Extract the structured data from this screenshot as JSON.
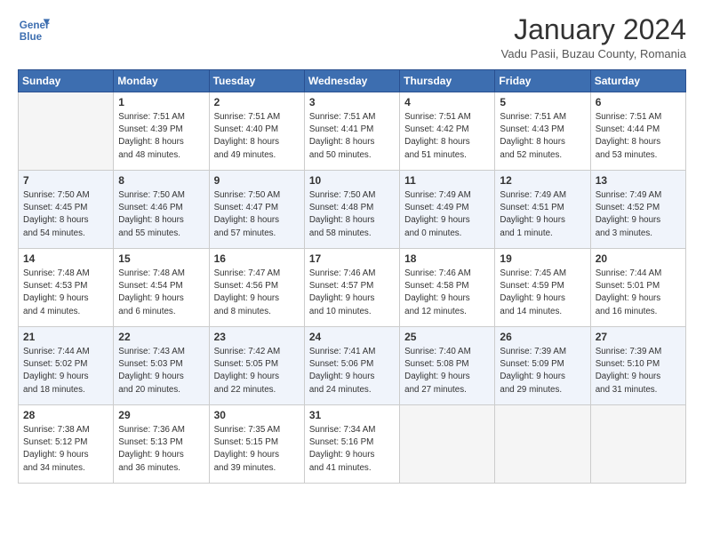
{
  "header": {
    "logo_line1": "General",
    "logo_line2": "Blue",
    "month_title": "January 2024",
    "location": "Vadu Pasii, Buzau County, Romania"
  },
  "days_of_week": [
    "Sunday",
    "Monday",
    "Tuesday",
    "Wednesday",
    "Thursday",
    "Friday",
    "Saturday"
  ],
  "weeks": [
    [
      {
        "num": "",
        "info": ""
      },
      {
        "num": "1",
        "info": "Sunrise: 7:51 AM\nSunset: 4:39 PM\nDaylight: 8 hours\nand 48 minutes."
      },
      {
        "num": "2",
        "info": "Sunrise: 7:51 AM\nSunset: 4:40 PM\nDaylight: 8 hours\nand 49 minutes."
      },
      {
        "num": "3",
        "info": "Sunrise: 7:51 AM\nSunset: 4:41 PM\nDaylight: 8 hours\nand 50 minutes."
      },
      {
        "num": "4",
        "info": "Sunrise: 7:51 AM\nSunset: 4:42 PM\nDaylight: 8 hours\nand 51 minutes."
      },
      {
        "num": "5",
        "info": "Sunrise: 7:51 AM\nSunset: 4:43 PM\nDaylight: 8 hours\nand 52 minutes."
      },
      {
        "num": "6",
        "info": "Sunrise: 7:51 AM\nSunset: 4:44 PM\nDaylight: 8 hours\nand 53 minutes."
      }
    ],
    [
      {
        "num": "7",
        "info": "Sunrise: 7:50 AM\nSunset: 4:45 PM\nDaylight: 8 hours\nand 54 minutes."
      },
      {
        "num": "8",
        "info": "Sunrise: 7:50 AM\nSunset: 4:46 PM\nDaylight: 8 hours\nand 55 minutes."
      },
      {
        "num": "9",
        "info": "Sunrise: 7:50 AM\nSunset: 4:47 PM\nDaylight: 8 hours\nand 57 minutes."
      },
      {
        "num": "10",
        "info": "Sunrise: 7:50 AM\nSunset: 4:48 PM\nDaylight: 8 hours\nand 58 minutes."
      },
      {
        "num": "11",
        "info": "Sunrise: 7:49 AM\nSunset: 4:49 PM\nDaylight: 9 hours\nand 0 minutes."
      },
      {
        "num": "12",
        "info": "Sunrise: 7:49 AM\nSunset: 4:51 PM\nDaylight: 9 hours\nand 1 minute."
      },
      {
        "num": "13",
        "info": "Sunrise: 7:49 AM\nSunset: 4:52 PM\nDaylight: 9 hours\nand 3 minutes."
      }
    ],
    [
      {
        "num": "14",
        "info": "Sunrise: 7:48 AM\nSunset: 4:53 PM\nDaylight: 9 hours\nand 4 minutes."
      },
      {
        "num": "15",
        "info": "Sunrise: 7:48 AM\nSunset: 4:54 PM\nDaylight: 9 hours\nand 6 minutes."
      },
      {
        "num": "16",
        "info": "Sunrise: 7:47 AM\nSunset: 4:56 PM\nDaylight: 9 hours\nand 8 minutes."
      },
      {
        "num": "17",
        "info": "Sunrise: 7:46 AM\nSunset: 4:57 PM\nDaylight: 9 hours\nand 10 minutes."
      },
      {
        "num": "18",
        "info": "Sunrise: 7:46 AM\nSunset: 4:58 PM\nDaylight: 9 hours\nand 12 minutes."
      },
      {
        "num": "19",
        "info": "Sunrise: 7:45 AM\nSunset: 4:59 PM\nDaylight: 9 hours\nand 14 minutes."
      },
      {
        "num": "20",
        "info": "Sunrise: 7:44 AM\nSunset: 5:01 PM\nDaylight: 9 hours\nand 16 minutes."
      }
    ],
    [
      {
        "num": "21",
        "info": "Sunrise: 7:44 AM\nSunset: 5:02 PM\nDaylight: 9 hours\nand 18 minutes."
      },
      {
        "num": "22",
        "info": "Sunrise: 7:43 AM\nSunset: 5:03 PM\nDaylight: 9 hours\nand 20 minutes."
      },
      {
        "num": "23",
        "info": "Sunrise: 7:42 AM\nSunset: 5:05 PM\nDaylight: 9 hours\nand 22 minutes."
      },
      {
        "num": "24",
        "info": "Sunrise: 7:41 AM\nSunset: 5:06 PM\nDaylight: 9 hours\nand 24 minutes."
      },
      {
        "num": "25",
        "info": "Sunrise: 7:40 AM\nSunset: 5:08 PM\nDaylight: 9 hours\nand 27 minutes."
      },
      {
        "num": "26",
        "info": "Sunrise: 7:39 AM\nSunset: 5:09 PM\nDaylight: 9 hours\nand 29 minutes."
      },
      {
        "num": "27",
        "info": "Sunrise: 7:39 AM\nSunset: 5:10 PM\nDaylight: 9 hours\nand 31 minutes."
      }
    ],
    [
      {
        "num": "28",
        "info": "Sunrise: 7:38 AM\nSunset: 5:12 PM\nDaylight: 9 hours\nand 34 minutes."
      },
      {
        "num": "29",
        "info": "Sunrise: 7:36 AM\nSunset: 5:13 PM\nDaylight: 9 hours\nand 36 minutes."
      },
      {
        "num": "30",
        "info": "Sunrise: 7:35 AM\nSunset: 5:15 PM\nDaylight: 9 hours\nand 39 minutes."
      },
      {
        "num": "31",
        "info": "Sunrise: 7:34 AM\nSunset: 5:16 PM\nDaylight: 9 hours\nand 41 minutes."
      },
      {
        "num": "",
        "info": ""
      },
      {
        "num": "",
        "info": ""
      },
      {
        "num": "",
        "info": ""
      }
    ]
  ]
}
